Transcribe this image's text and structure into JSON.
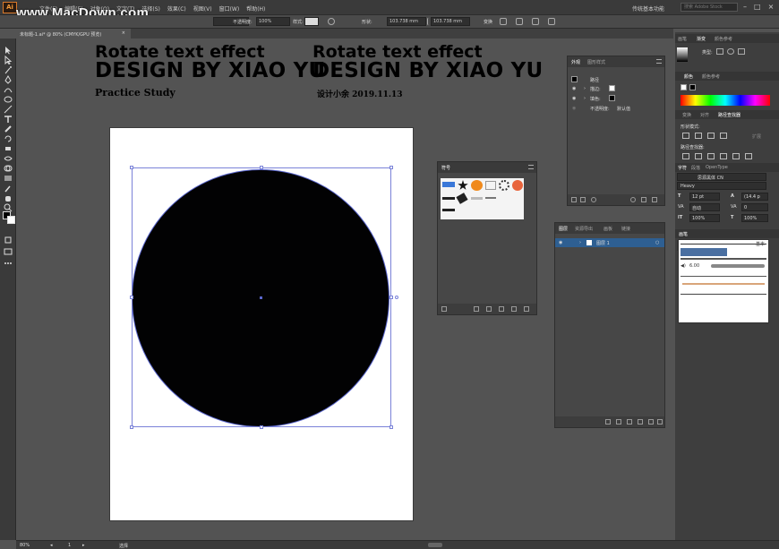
{
  "menubar": {
    "menus": [
      "文件(F)",
      "编辑(E)",
      "对象(O)",
      "文字(T)",
      "选择(S)",
      "效果(C)",
      "视图(V)",
      "窗口(W)",
      "帮助(H)"
    ],
    "workspace": "传统基本功能",
    "search_placeholder": "搜索 Adobe Stock",
    "app_icon": "Ai"
  },
  "watermark": "www.MacDown.com",
  "control": {
    "opacity_label": "不透明度:",
    "opacity_value": "100%",
    "style_label": "样式:",
    "shape_label": "形状:",
    "w_value": "103.738 mm",
    "h_value": "103.738 mm",
    "transform_label": "变换"
  },
  "document": {
    "tab_title": "未标题-1.ai* @ 80% (CMYK/GPU 预览)"
  },
  "overlay": {
    "left": {
      "line1": "Rotate text effect",
      "line2": "DESIGN BY XIAO YU",
      "line3": "Practice  Study"
    },
    "right": {
      "line1": "Rotate text effect",
      "line2": "DESIGN BY XIAO YU",
      "line3": "设计小余  2019.11.13"
    }
  },
  "appearance_panel": {
    "tabs": [
      "外观",
      "图形样式"
    ],
    "rows": {
      "path": "路径",
      "stroke": "描边:",
      "fill": "填色:",
      "opacity": "不透明度:",
      "opacity_value": "默认值"
    }
  },
  "symbols_panel": {
    "tabs": [
      "符号"
    ]
  },
  "layers_panel": {
    "tabs": [
      "图层",
      "资源导出",
      "画板",
      "链接"
    ],
    "layer_name": "图层 1"
  },
  "right_dock": {
    "gradient_tabs": [
      "画笔",
      "渐变",
      "颜色参考"
    ],
    "gradient_type_label": "类型:",
    "color_tabs": [
      "颜色",
      "颜色参考"
    ],
    "pathfinder_tabs": [
      "变换",
      "对齐",
      "路径查找器"
    ],
    "shape_mode_label": "形状模式:",
    "pathfinder_label": "路径查找器:",
    "expand_label": "扩展",
    "char_tabs": [
      "字符",
      "段落",
      "OpenType"
    ],
    "font_family": "思源黑体 CN",
    "font_style": "Heavy",
    "font_size": "12 pt",
    "leading": "(14.4 p",
    "tracking": "0",
    "kerning": "自动",
    "hscale": "100%",
    "vscale": "100%",
    "brushes_tab": "画笔",
    "brush_basic": "基本",
    "brush_size": "6.00"
  },
  "statusbar": {
    "zoom": "80%",
    "page": "1",
    "mode": "选择"
  }
}
